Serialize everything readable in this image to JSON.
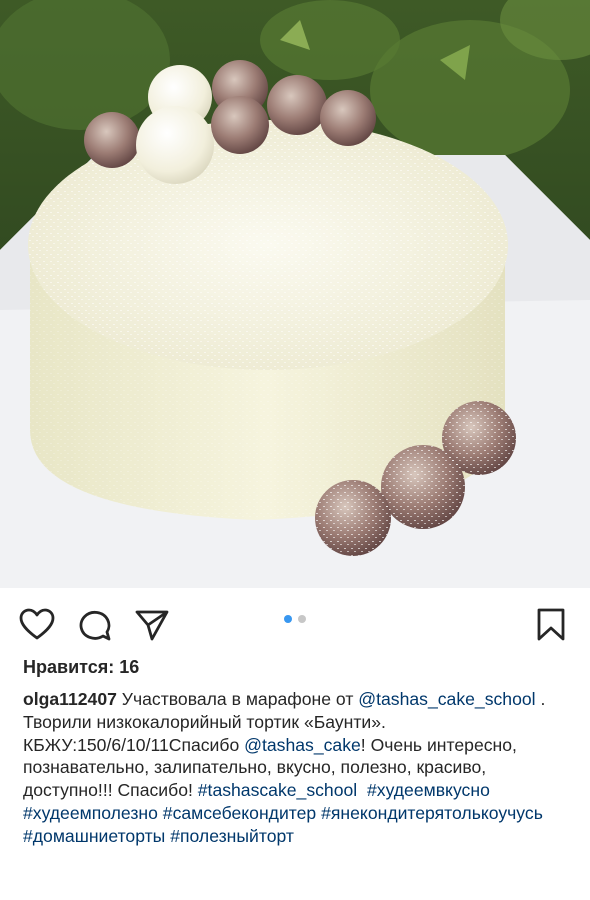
{
  "actions": {
    "like_icon": "heart-icon",
    "comment_icon": "comment-bubble-icon",
    "share_icon": "paper-plane-icon",
    "save_icon": "bookmark-icon"
  },
  "carousel": {
    "active_index": 1,
    "total": 2,
    "active_color": "#3897f0",
    "inactive_color": "#c7c7c7"
  },
  "likes": {
    "label": "Нравится: 16"
  },
  "caption": {
    "username": "olga112407",
    "text_1": " Участвовала в марафоне от ",
    "mention_1": "@tashas_cake_school",
    "text_2": " . Творили низкокалорийный тортик «Баунти». КБЖУ:150/6/10/11Спасибо ",
    "mention_2": "@tashas_cake",
    "text_3": "! Очень интересно, познавательно, залипательно, вкусно, полезно, красиво, доступно!!! Спасибо! ",
    "hashtags": [
      "#tashascake_school",
      "#худеемвкусно",
      "#худеемполезно",
      "#самсебекондитер",
      "#янекондитерятолькоучусь",
      "#домашниеторты",
      "#полезныйторт"
    ]
  },
  "colors": {
    "text": "#262626",
    "link": "#00376b"
  }
}
